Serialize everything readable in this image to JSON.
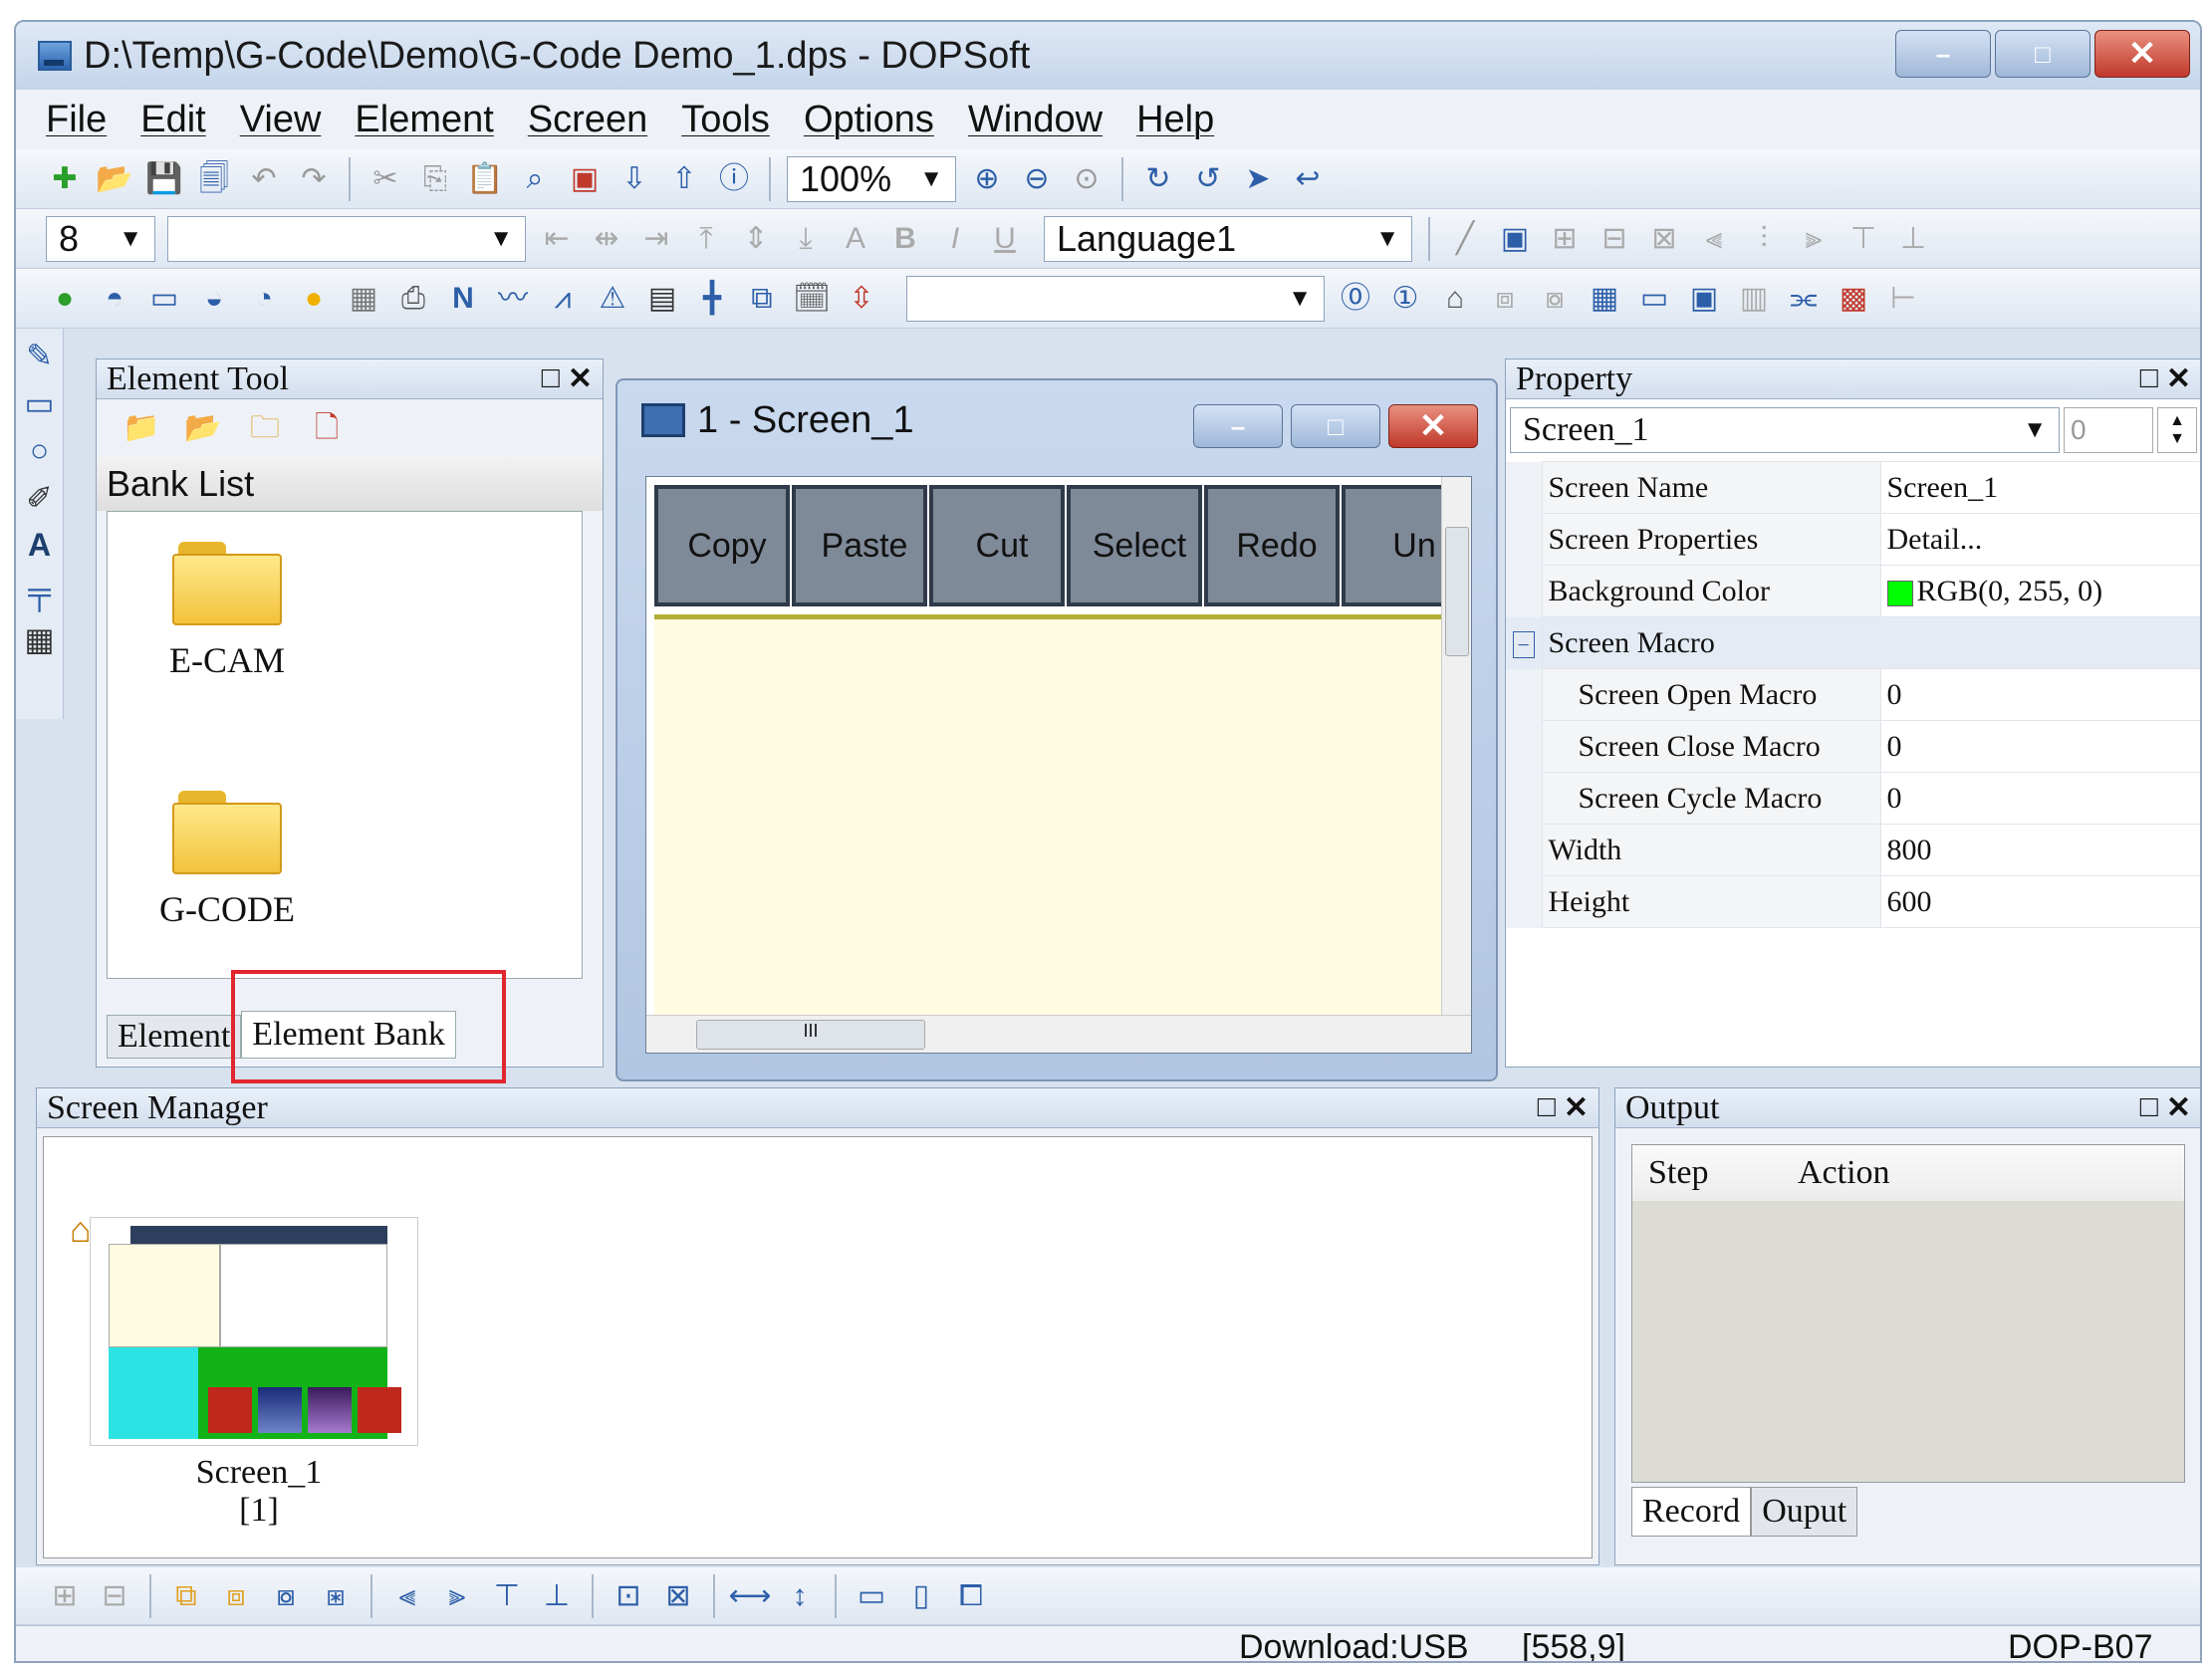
{
  "window": {
    "title": "D:\\Temp\\G-Code\\Demo\\G-Code Demo_1.dps - DOPSoft",
    "minimize": "–",
    "restore": "□",
    "close": "✕"
  },
  "menu": [
    "File",
    "Edit",
    "View",
    "Element",
    "Screen",
    "Tools",
    "Options",
    "Window",
    "Help"
  ],
  "toolbar": {
    "zoom": "100%",
    "font_size": "8",
    "font_name": "",
    "language": "Language1"
  },
  "element_tool": {
    "title": "Element Tool",
    "bank_list_label": "Bank List",
    "folders": [
      "E-CAM",
      "G-CODE"
    ],
    "tabs": [
      "Element",
      "Element Bank"
    ],
    "active_tab": "Element Bank"
  },
  "screen_window": {
    "title": "1 - Screen_1",
    "buttons": [
      "Copy",
      "Paste",
      "Cut",
      "Select",
      "Redo",
      "Un"
    ],
    "hscroll_thumb": "III"
  },
  "property": {
    "title": "Property",
    "selected": "Screen_1",
    "number": "0",
    "rows": [
      {
        "key": "Screen Name",
        "value": "Screen_1"
      },
      {
        "key": "Screen Properties",
        "value": "Detail..."
      },
      {
        "key": "Background Color",
        "value": "RGB(0, 255, 0)"
      },
      {
        "key": "Screen Macro",
        "value": ""
      },
      {
        "key": "Screen Open Macro",
        "value": "0"
      },
      {
        "key": "Screen Close Macro",
        "value": "0"
      },
      {
        "key": "Screen Cycle Macro",
        "value": "0"
      },
      {
        "key": "Width",
        "value": "800"
      },
      {
        "key": "Height",
        "value": "600"
      }
    ],
    "background_color_hex": "#00ff00",
    "group_toggle": "−"
  },
  "screen_manager": {
    "title": "Screen Manager",
    "thumb_name": "Screen_1",
    "thumb_id": "[1]"
  },
  "output": {
    "title": "Output",
    "columns": [
      "Step",
      "Action"
    ],
    "tabs": [
      "Record",
      "Ouput"
    ]
  },
  "status": {
    "download": "Download:USB",
    "coords": "[558,9]",
    "model": "DOP-B07"
  },
  "panel_controls": {
    "float": "□",
    "close": "✕"
  },
  "colors": {
    "accent_red": "#e0262f",
    "canvas_yellow": "#fefbe0"
  }
}
